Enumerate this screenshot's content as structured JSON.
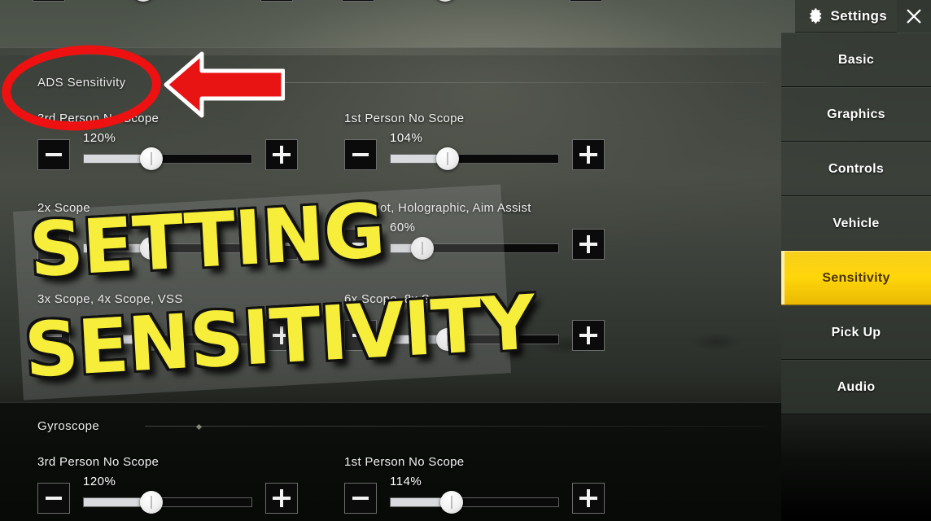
{
  "window": {
    "title": "Settings",
    "gear_icon": "gear-icon",
    "close_icon": "close-icon"
  },
  "sidebar": {
    "items": [
      {
        "label": "Basic",
        "active": false
      },
      {
        "label": "Graphics",
        "active": false
      },
      {
        "label": "Controls",
        "active": false
      },
      {
        "label": "Vehicle",
        "active": false
      },
      {
        "label": "Sensitivity",
        "active": true
      },
      {
        "label": "Pick Up",
        "active": false
      },
      {
        "label": "Audio",
        "active": false
      }
    ],
    "active_color": "#FFD60A",
    "active_text_color": "#4A3403"
  },
  "sections": [
    {
      "id": "ads",
      "title": "ADS Sensitivity",
      "rows": [
        {
          "label": "3rd Person No Scope",
          "value": "120%",
          "percent": 40
        },
        {
          "label": "1st Person No Scope",
          "value": "104%",
          "percent": 34
        },
        {
          "label": "2x Scope",
          "value": "",
          "percent": 40
        },
        {
          "label": "Red Dot, Holographic, Aim Assist",
          "value": "60%",
          "percent": 19
        },
        {
          "label": "3x Scope, 4x Scope, VSS",
          "value": "",
          "percent": 40
        },
        {
          "label": "6x Scope, 8x Scope",
          "value": "",
          "percent": 34
        }
      ]
    },
    {
      "id": "gyro",
      "title": "Gyroscope",
      "rows": [
        {
          "label": "3rd Person No Scope",
          "value": "120%",
          "percent": 40
        },
        {
          "label": "1st Person No Scope",
          "value": "114%",
          "percent": 36
        }
      ]
    }
  ],
  "controls": {
    "minus_label": "minus-button",
    "plus_label": "plus-button"
  },
  "annotations": {
    "circle_color": "#EE1111",
    "arrow_color": "#E81414",
    "overlay_line1": "SETTING",
    "overlay_line2": "SENSITIVITY",
    "overlay_color": "#F6EE3A"
  }
}
